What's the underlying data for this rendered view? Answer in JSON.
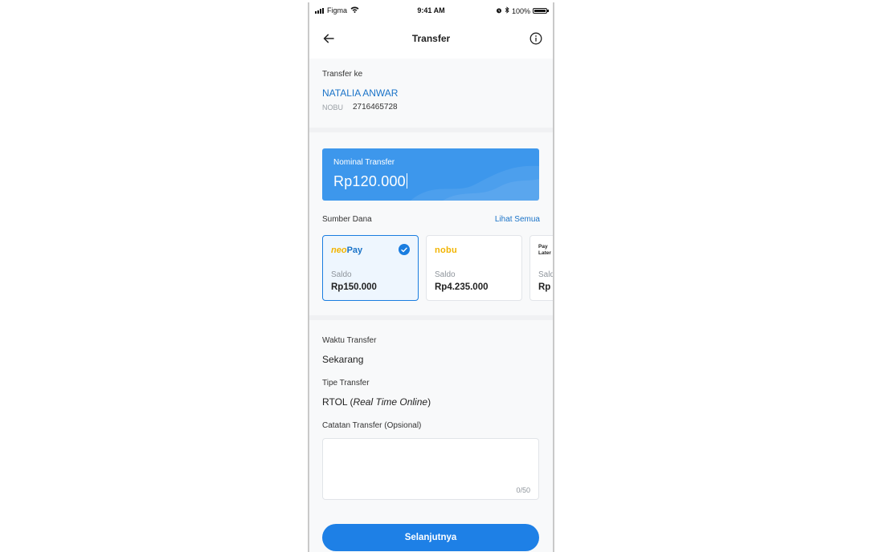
{
  "status_bar": {
    "carrier": "Figma",
    "time": "9:41 AM",
    "battery": "100%"
  },
  "header": {
    "title": "Transfer",
    "back_icon": "arrow-left-icon",
    "info_icon": "info-icon"
  },
  "recipient": {
    "label": "Transfer ke",
    "name": "NATALIA ANWAR",
    "bank": "NOBU",
    "account_number": "2716465728"
  },
  "nominal": {
    "label": "Nominal Transfer",
    "amount": "Rp120.000"
  },
  "source_funds": {
    "label": "Sumber Dana",
    "see_all": "Lihat Semua",
    "cards": [
      {
        "brand_prefix": "neo",
        "brand_suffix": "Pay",
        "saldo_label": "Saldo",
        "amount": "Rp150.000",
        "selected": true
      },
      {
        "brand": "nobu",
        "saldo_label": "Saldo",
        "amount": "Rp4.235.000",
        "selected": false
      },
      {
        "brand_line1": "Pay",
        "brand_line2": "Later",
        "saldo_label": "Saldo",
        "amount": "Rp",
        "selected": false
      }
    ]
  },
  "transfer_time": {
    "label": "Waktu Transfer",
    "value": "Sekarang"
  },
  "transfer_type": {
    "label": "Tipe Transfer",
    "value_prefix": "RTOL (",
    "value_italic": "Real Time Online",
    "value_suffix": ")"
  },
  "notes": {
    "label": "Catatan Transfer (Opsional)",
    "counter": "0/50",
    "placeholder": ""
  },
  "next_button": {
    "label": "Selanjutnya"
  },
  "colors": {
    "primary": "#1e80e6",
    "nominal_bg": "#3d97ec",
    "link": "#1a73c8",
    "section_bg": "#f8f9fa",
    "divider": "#eef1f4"
  }
}
